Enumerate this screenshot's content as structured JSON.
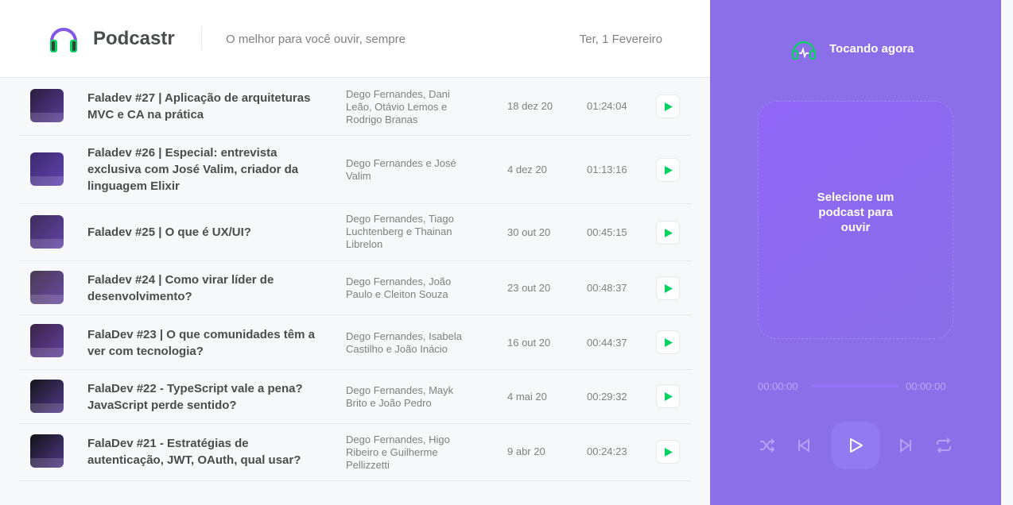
{
  "header": {
    "brand": "Podcastr",
    "tagline": "O melhor para você ouvir, sempre",
    "date": "Ter, 1 Fevereiro"
  },
  "episodes": [
    {
      "title": "Faladev #27 | Aplicação de arquiteturas MVC e CA na prática",
      "members": "Dego Fernandes, Dani Leão, Otávio Lemos e Rodrigo Branas",
      "published": "18 dez 20",
      "duration": "01:24:04",
      "thumb_color": "#2a1d3d"
    },
    {
      "title": "Faladev #26 | Especial: entrevista exclusiva com José Valim, criador da linguagem Elixir",
      "members": "Dego Fernandes e José Valim",
      "published": "4 dez 20",
      "duration": "01:13:16",
      "thumb_color": "#3b2a6e"
    },
    {
      "title": "Faladev #25 | O que é UX/UI?",
      "members": "Dego Fernandes, Tiago Luchtenberg e Thainan Librelon",
      "published": "30 out 20",
      "duration": "00:45:15",
      "thumb_color": "#3d2c5a"
    },
    {
      "title": "Faladev #24 | Como virar líder de desenvolvimento?",
      "members": "Dego Fernandes, João Paulo e Cleiton Souza",
      "published": "23 out 20",
      "duration": "00:48:37",
      "thumb_color": "#4a3a52"
    },
    {
      "title": "FalaDev #23 | O que comunidades têm a ver com tecnologia?",
      "members": "Dego Fernandes, Isabela Castilho e João Inácio",
      "published": "16 out 20",
      "duration": "00:44:37",
      "thumb_color": "#3a2346"
    },
    {
      "title": "FalaDev #22 - TypeScript vale a pena? JavaScript perde sentido?",
      "members": "Dego Fernandes, Mayk Brito e João Pedro",
      "published": "4 mai 20",
      "duration": "00:29:32",
      "thumb_color": "#15151a"
    },
    {
      "title": "FalaDev #21 - Estratégias de autenticação, JWT, OAuth, qual usar?",
      "members": "Dego Fernandes, Higo Ribeiro e Guilherme Pellizzetti",
      "published": "9 abr 20",
      "duration": "00:24:23",
      "thumb_color": "#121216"
    }
  ],
  "player": {
    "now_playing": "Tocando agora",
    "empty_message": "Selecione um podcast para ouvir",
    "time_current": "00:00:00",
    "time_total": "00:00:00"
  },
  "colors": {
    "accent": "#8257e5",
    "play_green": "#04d361"
  }
}
